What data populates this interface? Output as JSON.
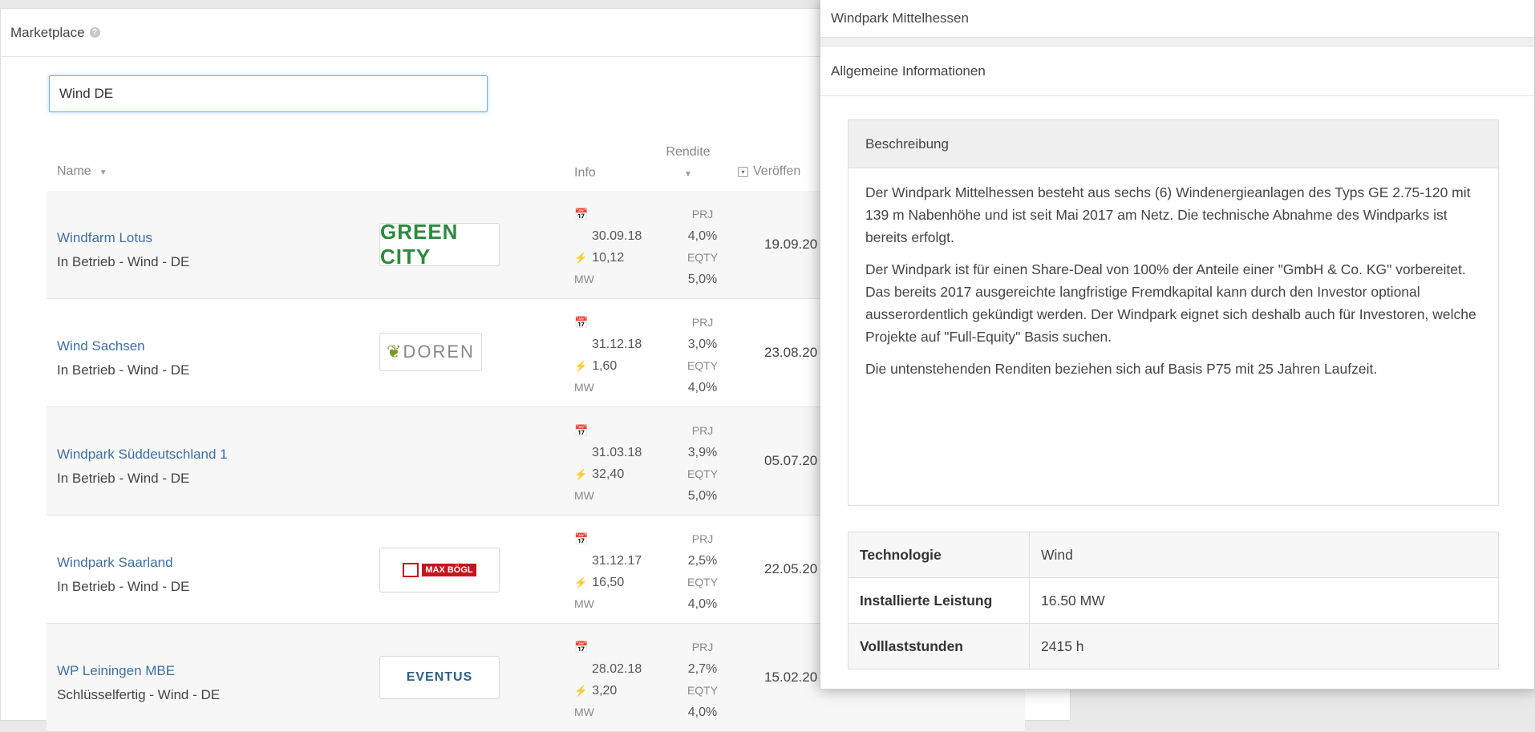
{
  "marketplace": {
    "title": "Marketplace",
    "search_value": "Wind DE",
    "columns": {
      "name": "Name",
      "info": "Info",
      "rendite": "Rendite",
      "published": "Veröffen"
    },
    "rows": [
      {
        "name": "Windfarm Lotus",
        "status": "In Betrieb - Wind - DE",
        "logo": "GREEN CITY",
        "date": "30.09.18",
        "capacity": "10,12",
        "unit": "MW",
        "prj_label": "PRJ",
        "prj": "4,0%",
        "eqty_label": "EQTY",
        "eqty": "5,0%",
        "published": "19.09.20"
      },
      {
        "name": "Wind Sachsen",
        "status": "In Betrieb - Wind - DE",
        "logo": "DOREN",
        "date": "31.12.18",
        "capacity": "1,60",
        "unit": "MW",
        "prj_label": "PRJ",
        "prj": "3,0%",
        "eqty_label": "EQTY",
        "eqty": "4,0%",
        "published": "23.08.20"
      },
      {
        "name": "Windpark Süddeutschland 1",
        "status": "In Betrieb - Wind - DE",
        "logo": "",
        "date": "31.03.18",
        "capacity": "32,40",
        "unit": "MW",
        "prj_label": "PRJ",
        "prj": "3,9%",
        "eqty_label": "EQTY",
        "eqty": "5,0%",
        "published": "05.07.20"
      },
      {
        "name": "Windpark Saarland",
        "status": "In Betrieb - Wind - DE",
        "logo": "MAX BÖGL",
        "date": "31.12.17",
        "capacity": "16,50",
        "unit": "MW",
        "prj_label": "PRJ",
        "prj": "2,5%",
        "eqty_label": "EQTY",
        "eqty": "4,0%",
        "published": "22.05.20"
      },
      {
        "name": "WP Leiningen MBE",
        "status": "Schlüsselfertig - Wind - DE",
        "logo": "EVENTUS",
        "date": "28.02.18",
        "capacity": "3,20",
        "unit": "MW",
        "prj_label": "PRJ",
        "prj": "2,7%",
        "eqty_label": "EQTY",
        "eqty": "4,0%",
        "published": "15.02.20"
      }
    ]
  },
  "detail": {
    "title": "Windpark Mittelhessen",
    "section": "Allgemeine Informationen",
    "description_title": "Beschreibung",
    "paragraphs": [
      "Der Windpark Mittelhessen besteht aus sechs (6) Windenergieanlagen des Typs GE 2.75-120 mit 139 m Nabenhöhe und ist seit Mai 2017 am Netz. Die technische Abnahme des Windparks ist bereits erfolgt.",
      "Der Windpark ist für einen Share-Deal von 100% der Anteile einer \"GmbH & Co. KG\" vorbereitet. Das bereits 2017 ausgereichte langfristige Fremdkapital kann durch den Investor optional ausserordentlich gekündigt werden. Der Windpark eignet sich deshalb auch für Investoren, welche Projekte auf \"Full-Equity\" Basis suchen.",
      "Die untenstehenden Renditen beziehen sich auf Basis P75 mit 25 Jahren Laufzeit."
    ],
    "properties": [
      {
        "key": "Technologie",
        "value": "Wind"
      },
      {
        "key": "Installierte Leistung",
        "value": "16.50 MW"
      },
      {
        "key": "Volllaststunden",
        "value": "2415 h"
      }
    ]
  },
  "colors": {
    "link": "#3e6fa3",
    "accent_focus": "#66afe9",
    "green_city": "#2b8a3e",
    "max_bogl": "#c4161c"
  }
}
